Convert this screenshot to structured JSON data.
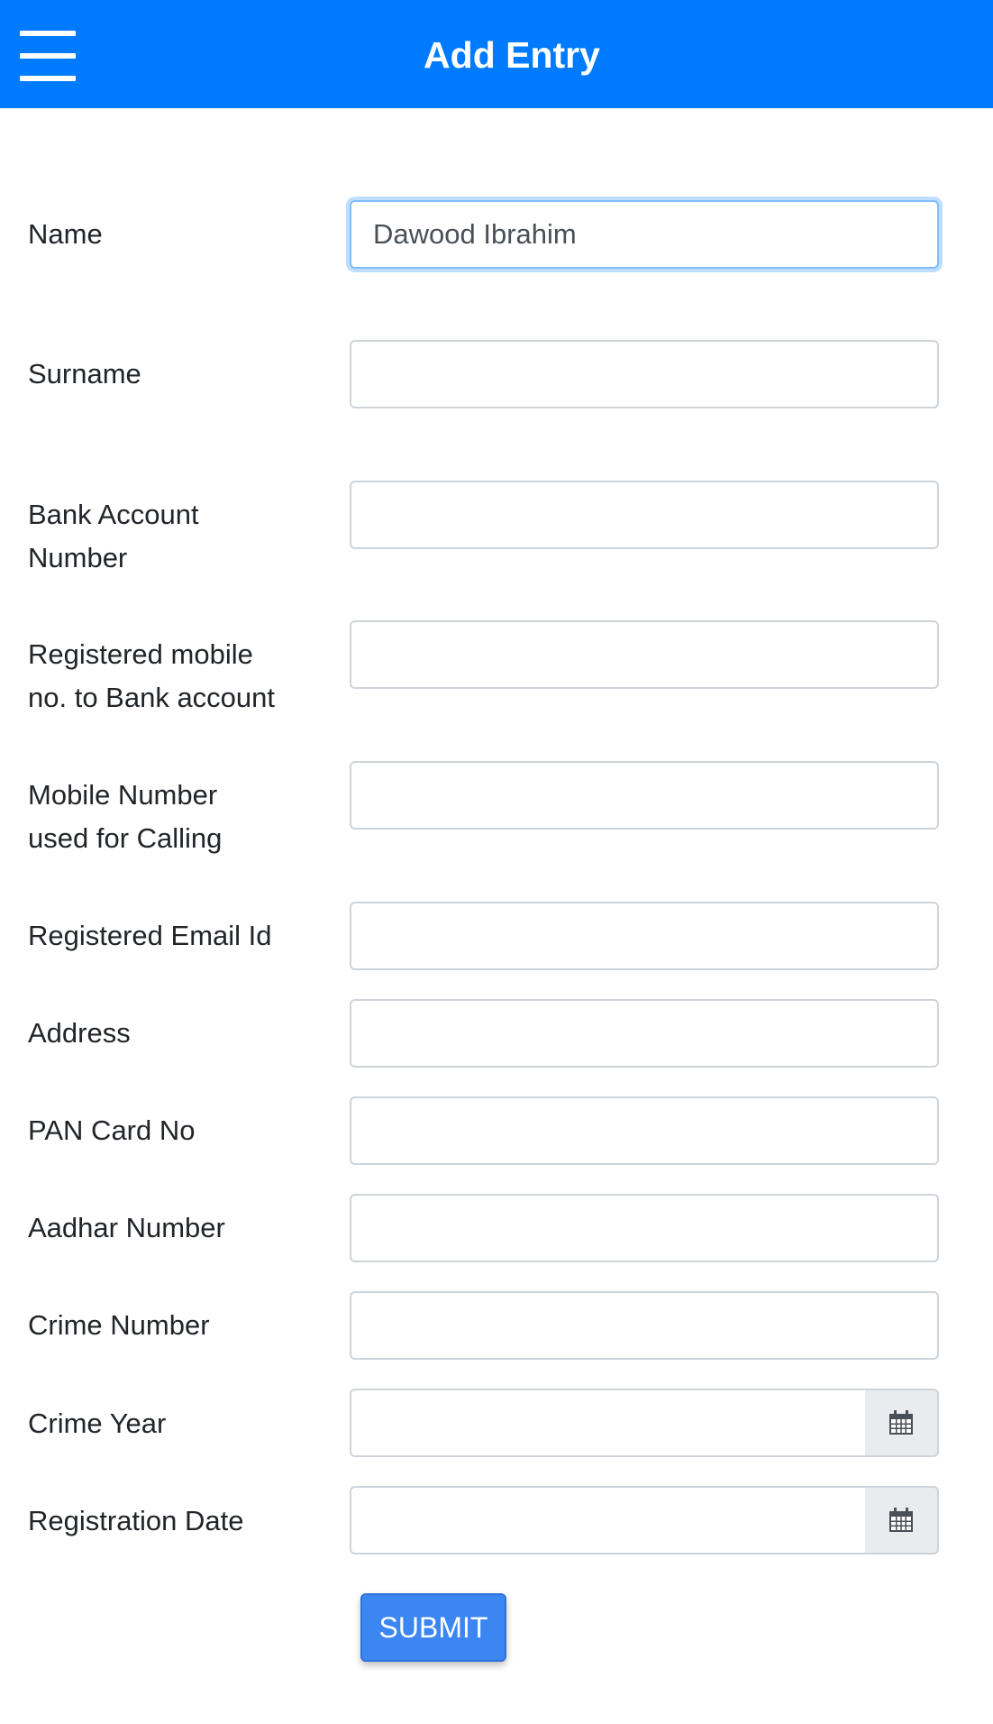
{
  "header": {
    "title": "Add Entry",
    "menu_icon": "hamburger-menu-icon",
    "background_color": "#007bff"
  },
  "form": {
    "name": {
      "label": "Name",
      "value": "Dawood Ibrahim"
    },
    "surname": {
      "label": "Surname",
      "value": ""
    },
    "bank_account": {
      "label_line1": "Bank Account",
      "label_line2": "Number",
      "value": ""
    },
    "registered_mobile": {
      "label_line1": "Registered mobile",
      "label_line2": "no. to Bank account",
      "value": ""
    },
    "calling_mobile": {
      "label_line1": "Mobile Number",
      "label_line2": "used for Calling",
      "value": ""
    },
    "email": {
      "label": "Registered Email Id",
      "value": ""
    },
    "address": {
      "label": "Address",
      "value": ""
    },
    "pan": {
      "label": "PAN Card No",
      "value": ""
    },
    "aadhar": {
      "label": "Aadhar Number",
      "value": ""
    },
    "crime_number": {
      "label": "Crime Number",
      "value": ""
    },
    "crime_year": {
      "label": "Crime Year",
      "value": "",
      "icon": "calendar-icon"
    },
    "registration_date": {
      "label": "Registration Date",
      "value": "",
      "icon": "calendar-icon"
    },
    "submit_label": "SUBMIT"
  }
}
